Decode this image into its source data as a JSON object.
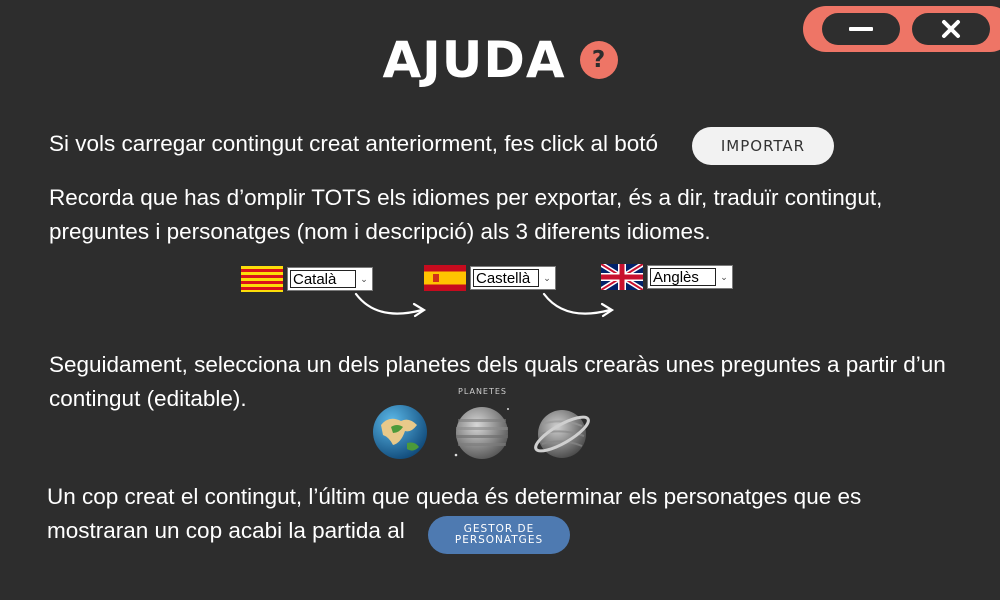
{
  "window": {
    "minimize_icon": "minus-icon",
    "close_icon": "close-icon",
    "close_glyph": "✕"
  },
  "header": {
    "title": "AJUDA",
    "help_glyph": "?"
  },
  "paragraphs": {
    "p1": "Si vols carregar contingut creat anteriorment, fes click al botó",
    "p2": "Recorda que has d’omplir TOTS els idiomes per exportar, és a dir, traduïr contingut, preguntes i personatges (nom i descripció) als 3 diferents idiomes.",
    "p3": "Seguidament, selecciona un dels planetes dels quals crearàs unes preguntes a partir d’un contingut (editable).",
    "p4": "Un cop creat el contingut, l’últim que queda és determinar els personatges que es mostraran un cop acabi la partida al"
  },
  "buttons": {
    "importar": "IMPORTAR",
    "gestor": "GESTOR DE PERSONATGES"
  },
  "languages": [
    {
      "label": "Català",
      "flag": "catalonia-flag"
    },
    {
      "label": "Castellà",
      "flag": "spain-flag"
    },
    {
      "label": "Anglès",
      "flag": "uk-flag"
    }
  ],
  "planets": {
    "label": "PLANETES",
    "items": [
      "earth-planet",
      "striped-planet",
      "ringed-planet"
    ]
  },
  "colors": {
    "background": "#2d2d2d",
    "accent": "#ee7566",
    "button_light": "#f2f2f2",
    "button_blue": "#4e7ab1"
  }
}
